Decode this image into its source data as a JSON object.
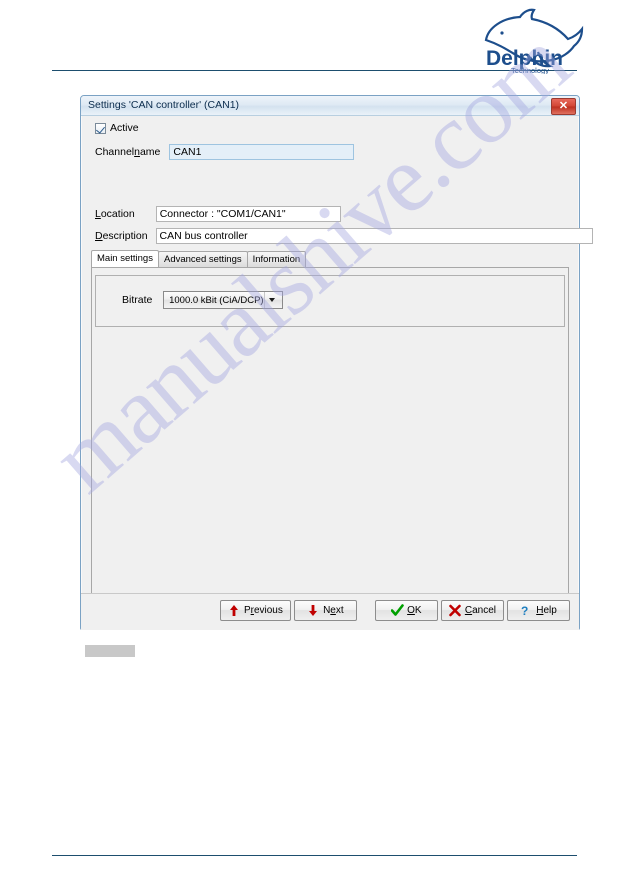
{
  "page": {
    "brand": {
      "name": "Delphin",
      "tagline": "Technology",
      "logo_icon": "dolphin-logo-icon",
      "color": "#1d4e8c"
    },
    "watermark": "manualshive.com"
  },
  "dialog": {
    "title": "Settings 'CAN controller' (CAN1)",
    "close_icon": "close-x-icon",
    "active_checkbox": {
      "label": "Active",
      "checked": true
    },
    "fields": [
      {
        "label_pre": "Channel",
        "label_accel": "n",
        "label_post": "ame",
        "value": "CAN1"
      },
      {
        "label_pre": "",
        "label_accel": "L",
        "label_post": "ocation",
        "value": "Connector : \"COM1/CAN1\""
      },
      {
        "label_pre": "",
        "label_accel": "D",
        "label_post": "escription",
        "value": "CAN bus controller"
      }
    ],
    "tabs": [
      {
        "label": "Main settings",
        "active": true
      },
      {
        "label": "Advanced settings",
        "active": false
      },
      {
        "label": "Information",
        "active": false
      }
    ],
    "main_settings": {
      "bitrate_label": "Bitrate",
      "bitrate_value": "1000.0 kBit (CiA/DCP)",
      "dropdown_icon": "chevron-down-icon"
    },
    "buttons": [
      {
        "name": "previous",
        "pre": "P",
        "accel": "r",
        "post": "evious",
        "icon": "arrow-up-icon",
        "color": "#c00000"
      },
      {
        "name": "next",
        "pre": "N",
        "accel": "e",
        "post": "xt",
        "icon": "arrow-down-icon",
        "color": "#c00000"
      },
      {
        "name": "ok",
        "pre": "",
        "accel": "O",
        "post": "K",
        "icon": "check-icon",
        "color": "#00a000"
      },
      {
        "name": "cancel",
        "pre": "",
        "accel": "C",
        "post": "ancel",
        "icon": "cross-icon",
        "color": "#c00000"
      },
      {
        "name": "help",
        "pre": "",
        "accel": "H",
        "post": "elp",
        "icon": "question-mark-icon",
        "color": "#1f7fc0"
      }
    ]
  }
}
